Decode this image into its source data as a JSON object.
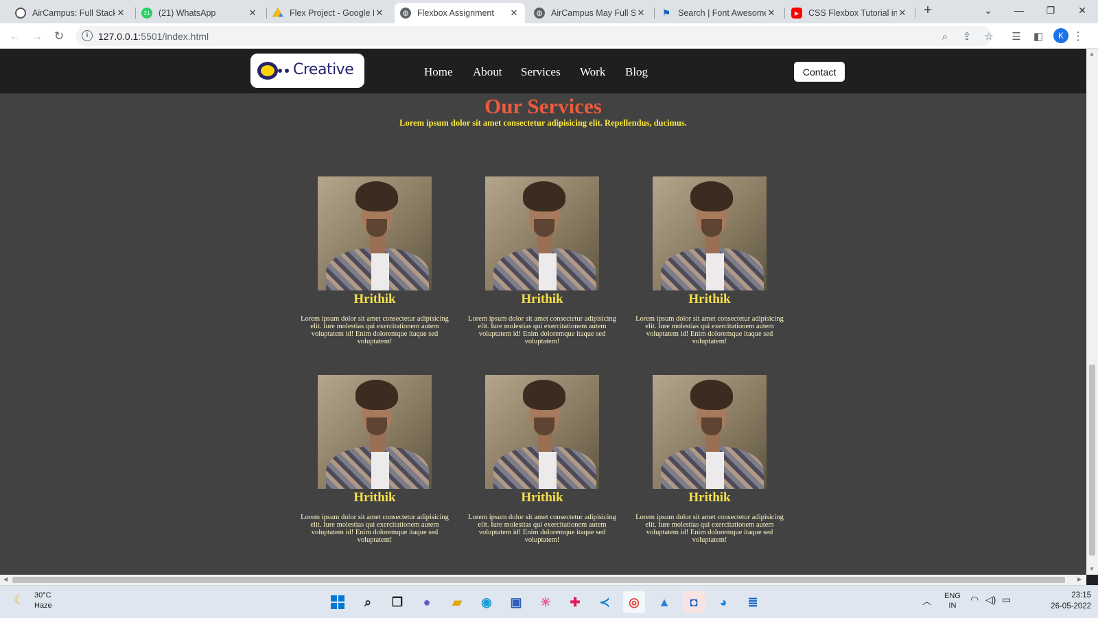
{
  "browser": {
    "tabs": [
      {
        "title": "AirCampus: Full Stack D",
        "icon": "aircampus-icon"
      },
      {
        "title": "(21) WhatsApp",
        "icon": "whatsapp-icon",
        "badge": "21"
      },
      {
        "title": "Flex Project - Google D",
        "icon": "google-drive-icon"
      },
      {
        "title": "Flexbox Assignment",
        "icon": "globe-icon",
        "active": true
      },
      {
        "title": "AirCampus May Full Sta",
        "icon": "globe-icon"
      },
      {
        "title": "Search | Font Awesome",
        "icon": "font-awesome-flag-icon"
      },
      {
        "title": "CSS Flexbox Tutorial in",
        "icon": "youtube-icon"
      }
    ],
    "url_host": "127.0.0.1",
    "url_path": ":5501/index.html",
    "profile_initial": "K"
  },
  "site": {
    "logo_text": "Creative",
    "nav": [
      "Home",
      "About",
      "Services",
      "Work",
      "Blog"
    ],
    "contact": "Contact",
    "heading": "Our Services",
    "subheading": "Lorem ipsum dolor sit amet consectetur adipisicing elit. Repellendus, ducimus.",
    "cards": [
      {
        "name": "Hrithik",
        "text": "Lorem ipsum dolor sit amet consectetur adipisicing elit. Iure molestias qui exercitationem autem voluptatem id! Enim doloremque itaque sed voluptatem!"
      },
      {
        "name": "Hrithik",
        "text": "Lorem ipsum dolor sit amet consectetur adipisicing elit. Iure molestias qui exercitationem autem voluptatem id! Enim doloremque itaque sed voluptatem!"
      },
      {
        "name": "Hrithik",
        "text": "Lorem ipsum dolor sit amet consectetur adipisicing elit. Iure molestias qui exercitationem autem voluptatem id! Enim doloremque itaque sed voluptatem!"
      },
      {
        "name": "Hrithik",
        "text": "Lorem ipsum dolor sit amet consectetur adipisicing elit. Iure molestias qui exercitationem autem voluptatem id! Enim doloremque itaque sed voluptatem!"
      },
      {
        "name": "Hrithik",
        "text": "Lorem ipsum dolor sit amet consectetur adipisicing elit. Iure molestias qui exercitationem autem voluptatem id! Enim doloremque itaque sed voluptatem!"
      },
      {
        "name": "Hrithik",
        "text": "Lorem ipsum dolor sit amet consectetur adipisicing elit. Iure molestias qui exercitationem autem voluptatem id! Enim doloremque itaque sed voluptatem!"
      }
    ]
  },
  "taskbar": {
    "temperature": "30°C",
    "condition": "Haze",
    "lang_top": "ENG",
    "lang_bottom": "IN",
    "time": "23:15",
    "date": "26-05-2022"
  },
  "colors": {
    "heading": "#ef5a3c",
    "subheading": "#ffeb3b",
    "card_name": "#f5e04a",
    "page_bg": "#424242",
    "nav_bg": "#1f1f1f"
  }
}
